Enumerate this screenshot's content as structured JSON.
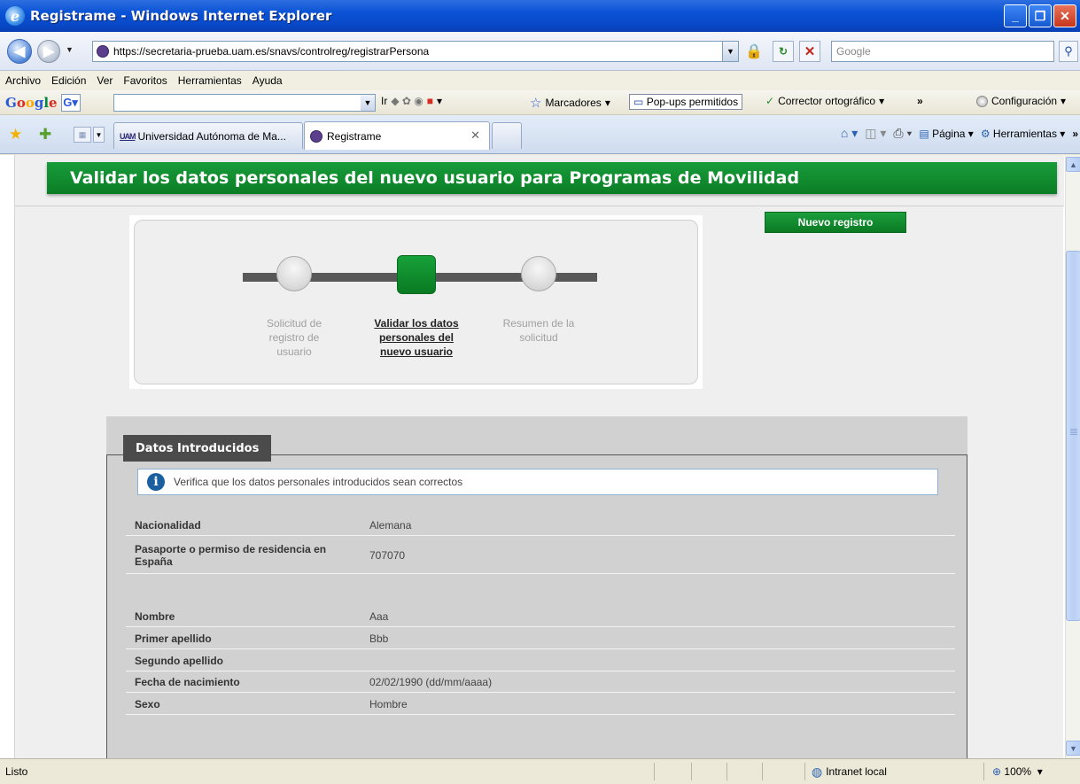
{
  "window": {
    "title": "Registrame - Windows Internet Explorer"
  },
  "address_bar": {
    "url": "https://secretaria-prueba.uam.es/snavs/controlreg/registrarPersona",
    "search_placeholder": "Google"
  },
  "menu": [
    "Archivo",
    "Edición",
    "Ver",
    "Favoritos",
    "Herramientas",
    "Ayuda"
  ],
  "google_toolbar": {
    "logo": [
      "G",
      "o",
      "o",
      "g",
      "l",
      "e"
    ],
    "g_button": "G",
    "go_label": "Ir",
    "bookmarks_label": "Marcadores",
    "popups_label": "Pop-ups permitidos",
    "spellcheck_label": "Corrector ortográfico",
    "more": "»",
    "settings_label": "Configuración"
  },
  "tabs": [
    {
      "label": "Universidad Autónoma de Ma...",
      "logo": "UAM"
    },
    {
      "label": "Registrame"
    }
  ],
  "command_bar": {
    "page_label": "Página",
    "tools_label": "Herramientas"
  },
  "page": {
    "banner": "Validar los datos personales del nuevo usuario para Programas de Movilidad",
    "new_registration_button": "Nuevo registro",
    "steps": [
      {
        "line1": "Solicitud de",
        "line2": "registro de",
        "line3": "usuario",
        "active": false
      },
      {
        "line1": "Validar los datos",
        "line2": "personales del",
        "line3": "nuevo usuario",
        "active": true
      },
      {
        "line1": "Resumen de la",
        "line2": "solicitud",
        "line3": "",
        "active": false
      }
    ],
    "section_title": "Datos Introducidos",
    "info_message": "Verifica que los datos personales introducidos sean correctos",
    "fields": {
      "nacionalidad": {
        "label": "Nacionalidad",
        "value": "Alemana"
      },
      "pasaporte": {
        "label_line1": "Pasaporte o permiso de residencia en",
        "label_line2": "España",
        "value": "707070"
      },
      "nombre": {
        "label": "Nombre",
        "value": "Aaa"
      },
      "primer_apellido": {
        "label": "Primer apellido",
        "value": "Bbb"
      },
      "segundo_apellido": {
        "label": "Segundo apellido",
        "value": ""
      },
      "fecha_nacimiento": {
        "label": "Fecha de nacimiento",
        "value": "02/02/1990 (dd/mm/aaaa)"
      },
      "sexo": {
        "label": "Sexo",
        "value": "Hombre"
      }
    }
  },
  "status_bar": {
    "status": "Listo",
    "zone": "Intranet local",
    "zoom": "100%"
  }
}
